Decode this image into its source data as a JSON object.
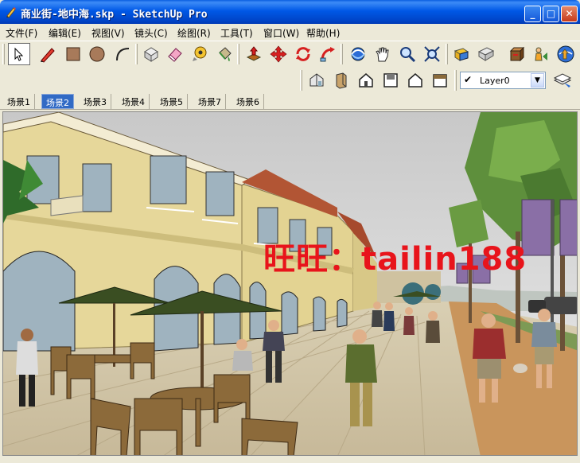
{
  "window": {
    "title": "商业街-地中海.skp - SketchUp Pro",
    "icon": "sketchup-pencil-icon"
  },
  "menu": [
    {
      "label": "文件(F)"
    },
    {
      "label": "编辑(E)"
    },
    {
      "label": "视图(V)"
    },
    {
      "label": "镜头(C)"
    },
    {
      "label": "绘图(R)"
    },
    {
      "label": "工具(T)"
    },
    {
      "label": "窗口(W)"
    },
    {
      "label": "帮助(H)"
    }
  ],
  "toolbar": {
    "tools": [
      "select-icon",
      "pencil-line-icon",
      "rectangle-icon",
      "circle-icon",
      "arc-icon",
      "make-component-icon",
      "eraser-icon",
      "tape-measure-icon",
      "paint-bucket-icon",
      "push-pull-icon",
      "move-icon",
      "rotate-icon",
      "follow-me-icon",
      "orbit-icon",
      "pan-icon",
      "zoom-icon",
      "zoom-extents-icon",
      "add-location-icon",
      "toggle-terrain-icon",
      "get-models-icon",
      "share-model-icon",
      "warehouse-icon"
    ],
    "views": [
      "iso-view-icon",
      "top-view-icon",
      "front-view-icon",
      "right-view-icon",
      "back-view-icon",
      "left-view-icon"
    ],
    "layer": {
      "selected": "Layer0",
      "checked": "✔"
    },
    "layers_button": "layer-manager-icon"
  },
  "scenes": [
    {
      "label": "场景1",
      "active": false
    },
    {
      "label": "场景2",
      "active": true
    },
    {
      "label": "场景3",
      "active": false
    },
    {
      "label": "场景4",
      "active": false
    },
    {
      "label": "场景5",
      "active": false
    },
    {
      "label": "场景7",
      "active": false
    },
    {
      "label": "场景6",
      "active": false
    }
  ],
  "viewport": {
    "description": "Mediterranean commercial street 3D model",
    "watermark": "旺旺：tailin188"
  },
  "colors": {
    "accent": "#316AC5",
    "watermark": "#E8141B",
    "building": "#E6D79A",
    "sky": "#D9D9D9"
  }
}
